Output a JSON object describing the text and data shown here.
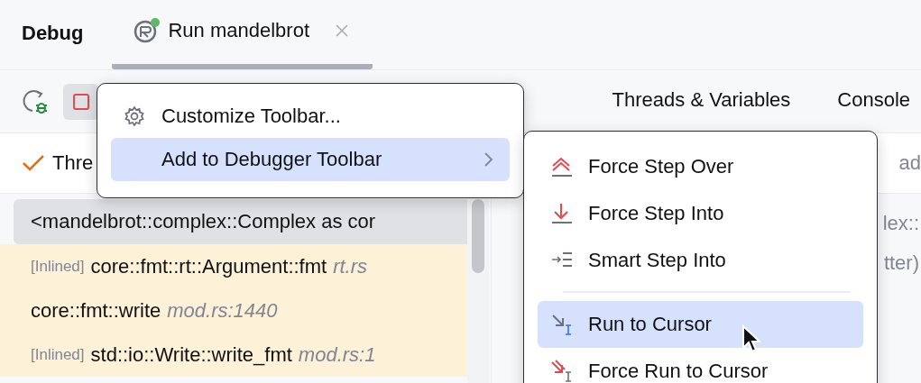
{
  "header": {
    "title": "Debug",
    "tabs": [
      {
        "label": "Run mandelbrot",
        "selected": true,
        "running": true
      }
    ]
  },
  "view_tabs": [
    {
      "label": "Threads & Variables",
      "selected": false
    },
    {
      "label": "Console",
      "selected": false
    }
  ],
  "filter": {
    "label": "Thre",
    "checked": true
  },
  "hint": "ad",
  "frames": [
    {
      "function": "<mandelbrot::complex::Complex as cor",
      "selected": true
    },
    {
      "tag": "[Inlined]",
      "function": "core::fmt::rt::Argument::fmt",
      "location": "rt.rs",
      "selected": false
    },
    {
      "function": "core::fmt::write",
      "location": "mod.rs:1440",
      "selected": false
    },
    {
      "tag": "[Inlined]",
      "function": "std::io::Write::write_fmt",
      "location": "mod.rs:1",
      "selected": false
    }
  ],
  "variables": [
    "lex::",
    "tter)"
  ],
  "context_menu": {
    "items": [
      {
        "label": "Customize Toolbar...",
        "selected": false,
        "submenu": false
      },
      {
        "label": "Add to Debugger Toolbar",
        "selected": true,
        "submenu": true
      }
    ]
  },
  "submenu": {
    "items": [
      {
        "kind": "action",
        "label": "Force Step Over",
        "selected": false
      },
      {
        "kind": "action",
        "label": "Force Step Into",
        "selected": false
      },
      {
        "kind": "action",
        "label": "Smart Step Into",
        "selected": false
      },
      {
        "kind": "separator"
      },
      {
        "kind": "action",
        "label": "Run to Cursor",
        "selected": true
      },
      {
        "kind": "action",
        "label": "Force Run to Cursor",
        "selected": false
      }
    ]
  }
}
